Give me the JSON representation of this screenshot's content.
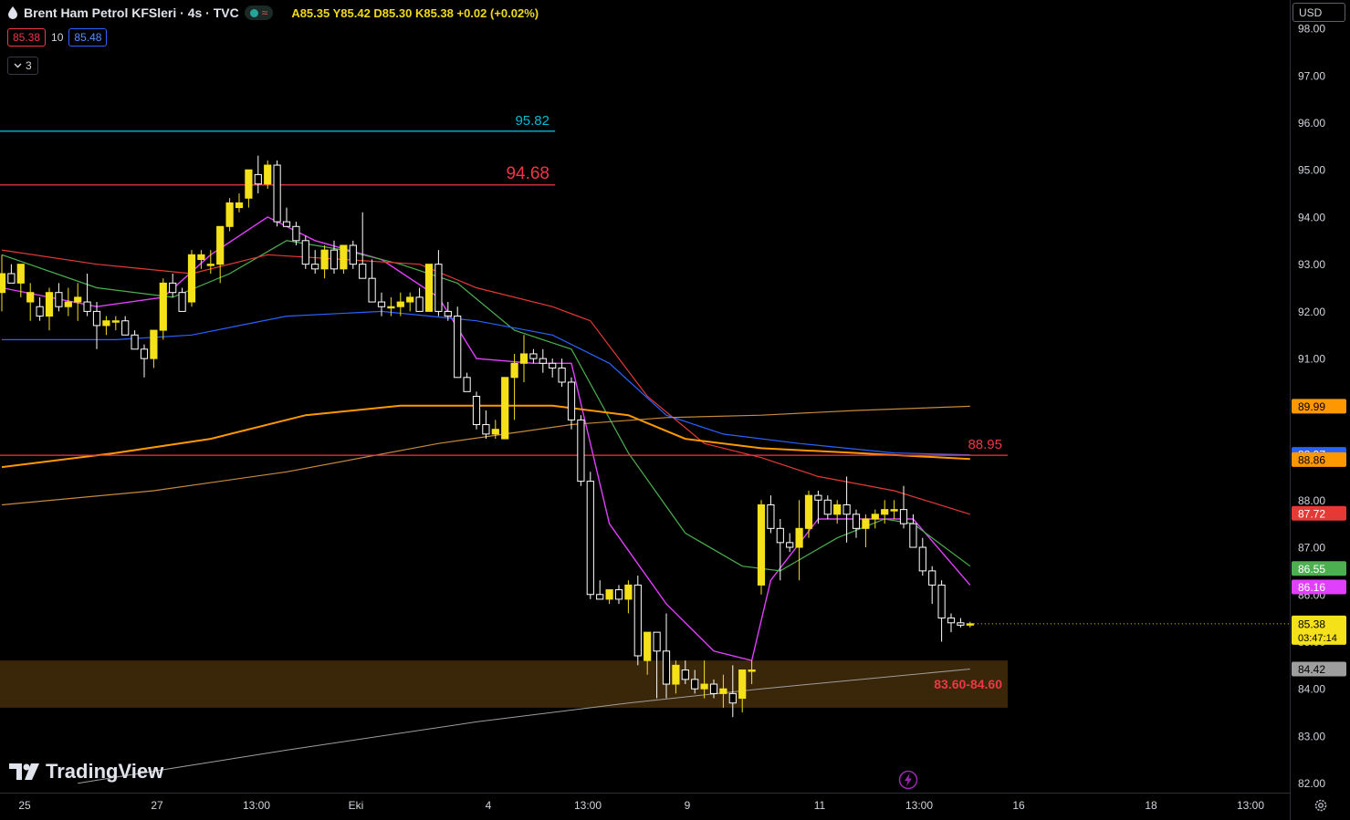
{
  "header": {
    "title": "Brent Ham Petrol KFSleri · 4s · TVC",
    "ohlc": "A85.35  Y85.42  D85.30  K85.38  +0.02 (+0.02%)",
    "bid": "85.38",
    "spread": "10",
    "ask": "85.48",
    "indicator_count": "3",
    "currency": "USD",
    "brand": "TradingView"
  },
  "colors": {
    "bg": "#000000",
    "bull": "#f5e11a",
    "bear_outline": "#ffffff",
    "ema_pink": "#e040fb",
    "ema_green": "#4caf50",
    "ema_red": "#e53935",
    "ema_blue": "#2962ff",
    "ema_orange": "#ff9800",
    "ema_tan": "#c68a3c",
    "ema_gray": "#9e9e9e",
    "line_cyan": "#00bcd4",
    "line_red": "#f23645",
    "zone": "#3a2608"
  },
  "chart_data": {
    "type": "candlestick",
    "yaxis": {
      "ylim": [
        81.8,
        98.6
      ],
      "ticks": [
        "98.00",
        "97.00",
        "96.00",
        "95.00",
        "94.00",
        "93.00",
        "92.00",
        "91.00",
        "90.00",
        "89.00",
        "88.00",
        "87.00",
        "86.00",
        "85.00",
        "84.00",
        "83.00",
        "82.00"
      ]
    },
    "xaxis": {
      "tick_labels": [
        "25",
        "27",
        "13:00",
        "Eki",
        "4",
        "13:00",
        "9",
        "11",
        "13:00",
        "16",
        "18",
        "13:00"
      ]
    },
    "candles": [
      [
        92.4,
        93.2,
        92.0,
        92.8
      ],
      [
        92.8,
        93.0,
        92.6,
        92.6
      ],
      [
        92.6,
        93.0,
        92.3,
        93.0
      ],
      [
        92.2,
        92.6,
        91.8,
        92.4
      ],
      [
        92.1,
        92.3,
        91.8,
        91.9
      ],
      [
        91.9,
        92.5,
        91.6,
        92.4
      ],
      [
        92.4,
        92.6,
        92.0,
        92.1
      ],
      [
        92.1,
        92.5,
        91.9,
        92.2
      ],
      [
        92.2,
        92.6,
        91.8,
        92.3
      ],
      [
        92.2,
        92.8,
        91.9,
        92.0
      ],
      [
        92.0,
        92.2,
        91.2,
        91.7
      ],
      [
        91.7,
        91.9,
        91.5,
        91.8
      ],
      [
        91.8,
        91.9,
        91.6,
        91.8
      ],
      [
        91.8,
        91.9,
        91.5,
        91.5
      ],
      [
        91.5,
        91.6,
        91.2,
        91.2
      ],
      [
        91.2,
        91.3,
        90.6,
        91.0
      ],
      [
        91.0,
        91.6,
        90.8,
        91.6
      ],
      [
        91.6,
        92.7,
        91.4,
        92.6
      ],
      [
        92.6,
        92.8,
        92.3,
        92.4
      ],
      [
        92.4,
        92.5,
        92.0,
        92.0
      ],
      [
        92.2,
        93.3,
        92.1,
        93.2
      ],
      [
        93.1,
        93.3,
        92.9,
        93.2
      ],
      [
        93.0,
        93.3,
        92.8,
        93.0
      ],
      [
        93.0,
        93.8,
        92.6,
        93.8
      ],
      [
        93.8,
        94.4,
        93.7,
        94.3
      ],
      [
        94.2,
        94.5,
        94.1,
        94.3
      ],
      [
        94.4,
        95.0,
        94.2,
        95.0
      ],
      [
        94.9,
        95.3,
        94.5,
        94.7
      ],
      [
        94.7,
        95.2,
        94.6,
        95.1
      ],
      [
        95.1,
        95.2,
        93.8,
        93.9
      ],
      [
        93.9,
        94.2,
        93.8,
        93.8
      ],
      [
        93.8,
        93.9,
        93.4,
        93.5
      ],
      [
        93.5,
        93.6,
        92.9,
        93.0
      ],
      [
        93.0,
        93.3,
        92.8,
        92.9
      ],
      [
        92.9,
        93.4,
        92.7,
        93.3
      ],
      [
        93.3,
        93.5,
        92.8,
        92.9
      ],
      [
        92.9,
        93.4,
        92.8,
        93.4
      ],
      [
        93.4,
        93.5,
        92.9,
        93.0
      ],
      [
        93.0,
        94.1,
        92.7,
        92.7
      ],
      [
        92.7,
        93.1,
        92.2,
        92.2
      ],
      [
        92.2,
        92.4,
        91.9,
        92.1
      ],
      [
        92.1,
        92.3,
        91.9,
        92.1
      ],
      [
        92.1,
        92.4,
        91.9,
        92.2
      ],
      [
        92.2,
        92.4,
        92.0,
        92.3
      ],
      [
        92.3,
        92.5,
        92.0,
        92.0
      ],
      [
        92.0,
        93.0,
        92.0,
        93.0
      ],
      [
        93.0,
        93.3,
        91.9,
        92.0
      ],
      [
        92.0,
        92.2,
        91.8,
        91.9
      ],
      [
        91.9,
        92.1,
        90.6,
        90.6
      ],
      [
        90.6,
        90.7,
        90.3,
        90.3
      ],
      [
        90.2,
        90.3,
        89.5,
        89.6
      ],
      [
        89.6,
        89.9,
        89.3,
        89.4
      ],
      [
        89.4,
        89.7,
        89.3,
        89.5
      ],
      [
        89.3,
        90.6,
        89.3,
        90.6
      ],
      [
        90.6,
        91.1,
        89.7,
        90.9
      ],
      [
        90.9,
        91.5,
        90.5,
        91.1
      ],
      [
        91.1,
        91.2,
        90.9,
        91.0
      ],
      [
        91.0,
        91.2,
        90.7,
        90.9
      ],
      [
        90.9,
        91.0,
        90.6,
        90.8
      ],
      [
        90.8,
        91.0,
        90.4,
        90.5
      ],
      [
        90.5,
        90.6,
        89.5,
        89.7
      ],
      [
        89.7,
        89.8,
        88.3,
        88.4
      ],
      [
        88.4,
        88.6,
        85.9,
        86.0
      ],
      [
        86.0,
        86.3,
        85.9,
        85.9
      ],
      [
        85.9,
        86.1,
        85.8,
        86.1
      ],
      [
        86.1,
        86.2,
        85.8,
        85.9
      ],
      [
        85.9,
        86.3,
        85.6,
        86.2
      ],
      [
        86.2,
        86.4,
        84.5,
        84.7
      ],
      [
        84.6,
        85.1,
        84.3,
        85.2
      ],
      [
        85.2,
        85.2,
        83.8,
        84.8
      ],
      [
        84.8,
        85.6,
        83.8,
        84.1
      ],
      [
        84.1,
        84.6,
        83.9,
        84.5
      ],
      [
        84.4,
        84.6,
        84.1,
        84.2
      ],
      [
        84.2,
        84.4,
        83.9,
        84.0
      ],
      [
        84.0,
        84.6,
        83.8,
        84.1
      ],
      [
        84.1,
        84.2,
        83.8,
        83.9
      ],
      [
        83.9,
        84.3,
        83.6,
        84.0
      ],
      [
        83.9,
        84.5,
        83.4,
        83.7
      ],
      [
        83.8,
        84.4,
        83.5,
        84.4
      ],
      [
        84.4,
        84.6,
        84.1,
        84.4
      ],
      [
        86.2,
        88.0,
        86.0,
        87.9
      ],
      [
        87.9,
        88.1,
        87.3,
        87.4
      ],
      [
        87.4,
        87.6,
        86.3,
        87.1
      ],
      [
        87.1,
        87.3,
        86.9,
        87.0
      ],
      [
        87.0,
        88.0,
        86.3,
        87.4
      ],
      [
        87.4,
        88.2,
        87.2,
        88.1
      ],
      [
        88.1,
        88.2,
        87.5,
        88.0
      ],
      [
        88.0,
        88.1,
        87.6,
        87.7
      ],
      [
        87.7,
        88.0,
        87.5,
        87.9
      ],
      [
        87.9,
        88.5,
        87.1,
        87.7
      ],
      [
        87.7,
        87.8,
        87.2,
        87.4
      ],
      [
        87.4,
        87.7,
        87.0,
        87.6
      ],
      [
        87.6,
        87.8,
        87.4,
        87.7
      ],
      [
        87.7,
        88.0,
        87.5,
        87.8
      ],
      [
        87.8,
        88.0,
        87.6,
        87.8
      ],
      [
        87.8,
        88.3,
        87.4,
        87.5
      ],
      [
        87.5,
        87.7,
        87.1,
        87.0
      ],
      [
        87.0,
        87.2,
        86.4,
        86.5
      ],
      [
        86.5,
        86.6,
        85.8,
        86.2
      ],
      [
        86.2,
        86.3,
        85.0,
        85.5
      ],
      [
        85.5,
        85.6,
        85.2,
        85.4
      ],
      [
        85.4,
        85.5,
        85.3,
        85.35
      ],
      [
        85.35,
        85.42,
        85.3,
        85.38
      ]
    ],
    "moving_averages": [
      {
        "color": "#e040fb",
        "width": 1.4,
        "points": [
          [
            0,
            92.5
          ],
          [
            10,
            92.1
          ],
          [
            17,
            92.3
          ],
          [
            22,
            93.2
          ],
          [
            28,
            94.0
          ],
          [
            33,
            93.5
          ],
          [
            40,
            93.1
          ],
          [
            46,
            92.3
          ],
          [
            50,
            91.0
          ],
          [
            56,
            90.9
          ],
          [
            60,
            90.9
          ],
          [
            64,
            87.5
          ],
          [
            70,
            85.8
          ],
          [
            75,
            84.8
          ],
          [
            79,
            84.6
          ],
          [
            81,
            86.3
          ],
          [
            86,
            87.6
          ],
          [
            93,
            87.6
          ],
          [
            96,
            87.6
          ],
          [
            102,
            86.2
          ]
        ]
      },
      {
        "color": "#4caf50",
        "width": 1.2,
        "points": [
          [
            0,
            93.2
          ],
          [
            10,
            92.5
          ],
          [
            18,
            92.3
          ],
          [
            24,
            92.8
          ],
          [
            30,
            93.5
          ],
          [
            36,
            93.3
          ],
          [
            42,
            93.0
          ],
          [
            48,
            92.6
          ],
          [
            54,
            91.6
          ],
          [
            60,
            91.2
          ],
          [
            66,
            89.0
          ],
          [
            72,
            87.3
          ],
          [
            78,
            86.6
          ],
          [
            82,
            86.5
          ],
          [
            88,
            87.2
          ],
          [
            93,
            87.6
          ],
          [
            96,
            87.5
          ],
          [
            102,
            86.6
          ]
        ]
      },
      {
        "color": "#e53935",
        "width": 1.2,
        "points": [
          [
            0,
            93.3
          ],
          [
            10,
            93.0
          ],
          [
            20,
            92.8
          ],
          [
            28,
            93.2
          ],
          [
            36,
            93.1
          ],
          [
            44,
            93.0
          ],
          [
            50,
            92.5
          ],
          [
            58,
            92.1
          ],
          [
            62,
            91.8
          ],
          [
            68,
            90.2
          ],
          [
            74,
            89.2
          ],
          [
            80,
            88.9
          ],
          [
            86,
            88.5
          ],
          [
            94,
            88.2
          ],
          [
            102,
            87.7
          ]
        ]
      },
      {
        "color": "#2962ff",
        "width": 1.2,
        "points": [
          [
            0,
            91.4
          ],
          [
            12,
            91.4
          ],
          [
            20,
            91.5
          ],
          [
            30,
            91.9
          ],
          [
            40,
            92.0
          ],
          [
            50,
            91.8
          ],
          [
            58,
            91.5
          ],
          [
            64,
            90.9
          ],
          [
            70,
            89.8
          ],
          [
            76,
            89.4
          ],
          [
            84,
            89.2
          ],
          [
            94,
            89.0
          ],
          [
            102,
            88.96
          ]
        ]
      },
      {
        "color": "#ff9800",
        "width": 2.0,
        "points": [
          [
            0,
            88.7
          ],
          [
            12,
            89.0
          ],
          [
            22,
            89.3
          ],
          [
            32,
            89.8
          ],
          [
            42,
            90.0
          ],
          [
            52,
            90.0
          ],
          [
            58,
            90.0
          ],
          [
            66,
            89.8
          ],
          [
            72,
            89.3
          ],
          [
            80,
            89.1
          ],
          [
            90,
            89.0
          ],
          [
            102,
            88.87
          ]
        ]
      },
      {
        "color": "#c68a3c",
        "width": 1.2,
        "points": [
          [
            0,
            87.9
          ],
          [
            16,
            88.2
          ],
          [
            30,
            88.6
          ],
          [
            46,
            89.2
          ],
          [
            60,
            89.6
          ],
          [
            70,
            89.75
          ],
          [
            80,
            89.8
          ],
          [
            90,
            89.9
          ],
          [
            102,
            89.99
          ]
        ]
      },
      {
        "color": "#9e9e9e",
        "width": 1.0,
        "points": [
          [
            8,
            82.0
          ],
          [
            30,
            82.7
          ],
          [
            50,
            83.3
          ],
          [
            66,
            83.7
          ],
          [
            80,
            84.0
          ],
          [
            102,
            84.42
          ]
        ]
      }
    ],
    "hlines": [
      {
        "price": 95.82,
        "label": "95.82",
        "color": "#00bcd4",
        "x_end": 608,
        "label_size": 15
      },
      {
        "price": 94.68,
        "label": "94.68",
        "color": "#f23645",
        "x_end": 608,
        "label_size": 19
      },
      {
        "price": 88.95,
        "label": "88.95",
        "color": "#f23645",
        "x_end": 1104,
        "label_size": 15
      }
    ],
    "zone": {
      "low": 83.6,
      "high": 84.6,
      "label": "83.60-84.60",
      "color": "#3a2608",
      "label_color": "#f23645"
    },
    "price_labels": [
      {
        "price": 89.99,
        "text": "89.99",
        "bg": "#ff9800",
        "fg": "#000000"
      },
      {
        "price": 88.97,
        "text": "88.97",
        "bg": "#2962ff",
        "fg": "#ffffff"
      },
      {
        "price": 88.86,
        "text": "88.86",
        "bg": "#ff9800",
        "fg": "#000000"
      },
      {
        "price": 87.72,
        "text": "87.72",
        "bg": "#e53935",
        "fg": "#ffffff"
      },
      {
        "price": 86.55,
        "text": "86.55",
        "bg": "#4caf50",
        "fg": "#ffffff"
      },
      {
        "price": 86.16,
        "text": "86.16",
        "bg": "#e040fb",
        "fg": "#ffffff"
      },
      {
        "price": 84.42,
        "text": "84.42",
        "bg": "#9e9e9e",
        "fg": "#000000"
      }
    ],
    "last_price": {
      "price": 85.38,
      "text": "85.38",
      "countdown": "03:47:14",
      "bg": "#f5e11a",
      "fg": "#000000"
    }
  }
}
